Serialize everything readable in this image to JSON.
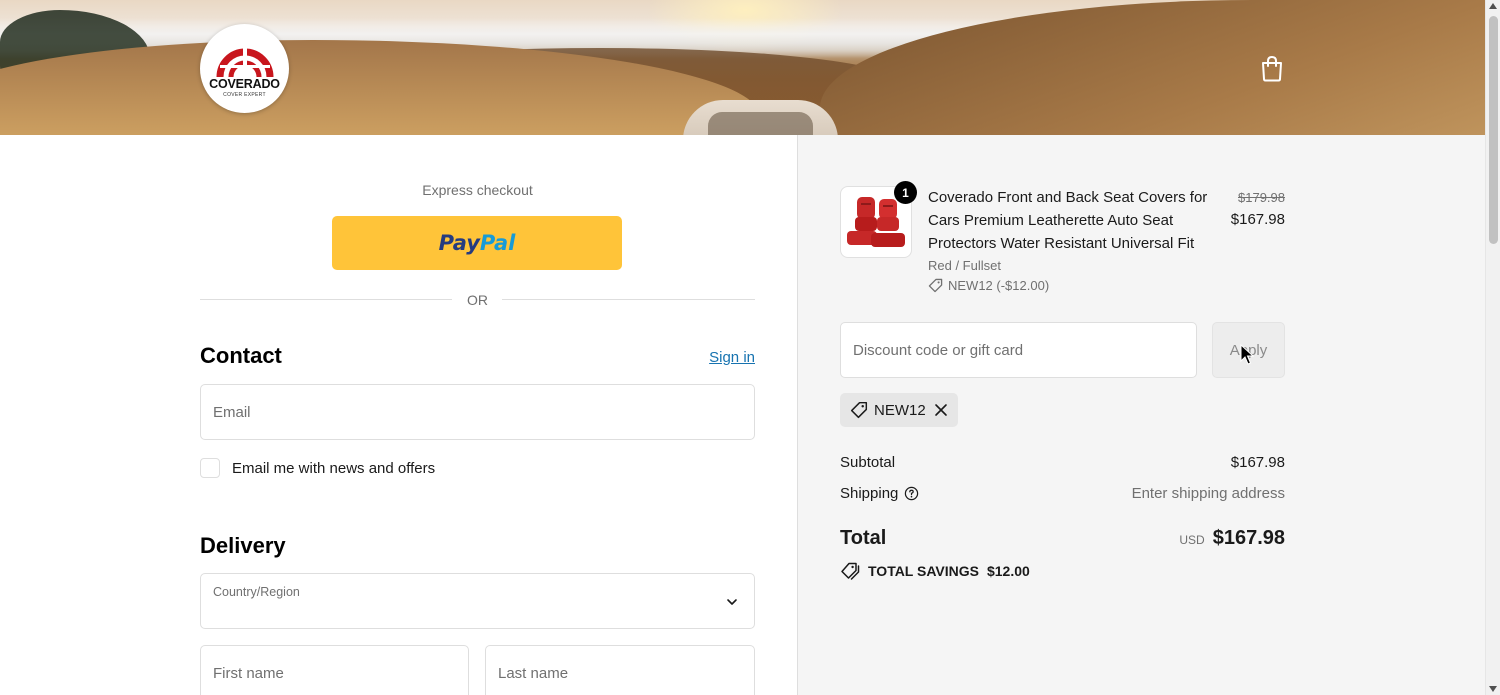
{
  "header": {
    "logo": {
      "brand": "COVERADO",
      "tagline": "COVER EXPERT"
    },
    "cart_icon": "shopping-bag-icon"
  },
  "express": {
    "label": "Express checkout",
    "paypal_part1": "Pay",
    "paypal_part2": "Pal",
    "divider": "OR"
  },
  "contact": {
    "title": "Contact",
    "signin": "Sign in",
    "email_placeholder": "Email",
    "newsletter_label": "Email me with news and offers"
  },
  "delivery": {
    "title": "Delivery",
    "country_label": "Country/Region",
    "first_name_placeholder": "First name",
    "last_name_placeholder": "Last name"
  },
  "order": {
    "item": {
      "quantity": "1",
      "title": "Coverado Front and Back Seat Covers for Cars Premium Leatherette Auto Seat Protectors Water Resistant Universal Fit",
      "variant": "Red / Fullset",
      "discount": "NEW12 (-$12.00)",
      "price_original": "$179.98",
      "price_current": "$167.98"
    },
    "discount_placeholder": "Discount code or gift card",
    "apply_label": "Apply",
    "applied_code": "NEW12",
    "subtotal_label": "Subtotal",
    "subtotal_value": "$167.98",
    "shipping_label": "Shipping",
    "shipping_value": "Enter shipping address",
    "total_label": "Total",
    "currency": "USD",
    "total_value": "$167.98",
    "savings_label": "TOTAL SAVINGS",
    "savings_value": "$12.00"
  },
  "colors": {
    "paypal_yellow": "#ffc439",
    "link_blue": "#1773b0",
    "logo_red": "#c8161d"
  }
}
